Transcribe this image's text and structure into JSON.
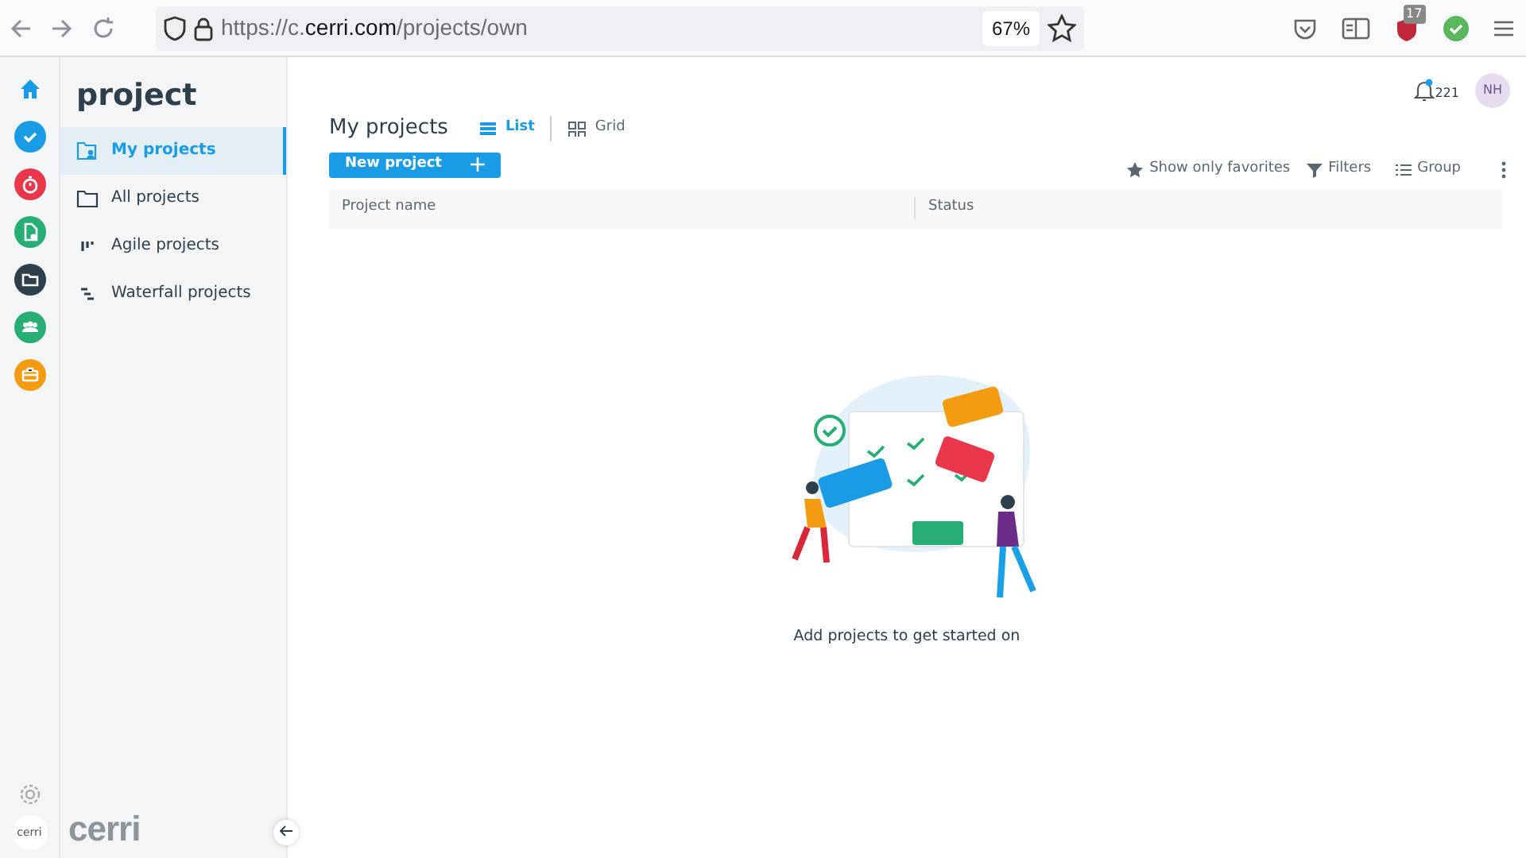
{
  "browser": {
    "url": {
      "prefix": "https://c.",
      "domain": "cerri.com",
      "path": "/projects/own"
    },
    "zoom": "67%",
    "extension_badge": "17"
  },
  "rail": {
    "items": [
      {
        "kind": "home",
        "color": "#1a9be6"
      },
      {
        "kind": "check",
        "color": "#1a9be6"
      },
      {
        "kind": "timer",
        "color": "#e8364a"
      },
      {
        "kind": "doc",
        "color": "#27ae74"
      },
      {
        "kind": "folder",
        "color": "#2d3e4c"
      },
      {
        "kind": "team",
        "color": "#27ae74"
      },
      {
        "kind": "case",
        "color": "#f39c12"
      }
    ],
    "avatar": "cerri"
  },
  "sidebar": {
    "title": "project",
    "items": [
      {
        "kind": "mine",
        "label": "My projects",
        "selected": true
      },
      {
        "kind": "all",
        "label": "All projects",
        "selected": false
      },
      {
        "kind": "agile",
        "label": "Agile projects",
        "selected": false
      },
      {
        "kind": "waterfall",
        "label": "Waterfall projects",
        "selected": false
      }
    ],
    "logo": "cerri"
  },
  "header": {
    "notification_count": "221",
    "avatar": "NH"
  },
  "main": {
    "title": "My projects",
    "views": [
      {
        "kind": "list",
        "label": "List",
        "selected": true
      },
      {
        "kind": "grid",
        "label": "Grid",
        "selected": false
      }
    ],
    "new_button": "New project",
    "toolbar": [
      {
        "kind": "star",
        "label": "Show only favorites"
      },
      {
        "kind": "filter",
        "label": "Filters"
      },
      {
        "kind": "group",
        "label": "Group"
      }
    ],
    "columns": [
      "Project name",
      "Status"
    ],
    "empty_message": "Add projects to get started on"
  }
}
